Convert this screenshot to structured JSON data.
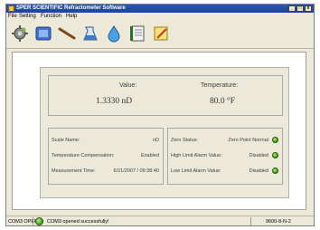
{
  "window": {
    "title": "SPER SCIENTIFIC Refractometer Software",
    "buttons": {
      "minimize": "_",
      "maximize": "□",
      "close": "x"
    }
  },
  "menu": [
    "File",
    "Setting",
    "Function",
    "Help"
  ],
  "toolbar": {
    "tools": [
      "gear-icon",
      "sample-tile-icon",
      "probe-icon",
      "beaker-icon",
      "drop-icon",
      "notebook-icon",
      "pencil-note-icon"
    ]
  },
  "reading": {
    "value_label": "Value:",
    "value": "1.3330 nD",
    "temperature_label": "Temperature:",
    "temperature": "80.0 °F"
  },
  "settings": {
    "scale_name_label": "Scale Name:",
    "scale_name": "nD",
    "temp_comp_label": "Temperature Compensation:",
    "temp_comp": "Enabled",
    "measurement_time_label": "Measurement Time:",
    "measurement_time": "6/21/2007 / 09:38:40"
  },
  "status": {
    "zero_status_label": "Zero Status:",
    "zero_status": "Zero Point Normal",
    "high_alarm_label": "High Limit Alarm Value:",
    "high_alarm": "Disabled",
    "low_alarm_label": "Low Limit Alarm Value:",
    "low_alarm": "Disabled"
  },
  "statusbar": {
    "port": "COM3 OPEN",
    "message": "COM3 opened successfully!",
    "settings": "9600-8-N-2"
  },
  "colors": {
    "led_green": "#3e9a12",
    "titlebar_blue": "#1c3fa6"
  }
}
